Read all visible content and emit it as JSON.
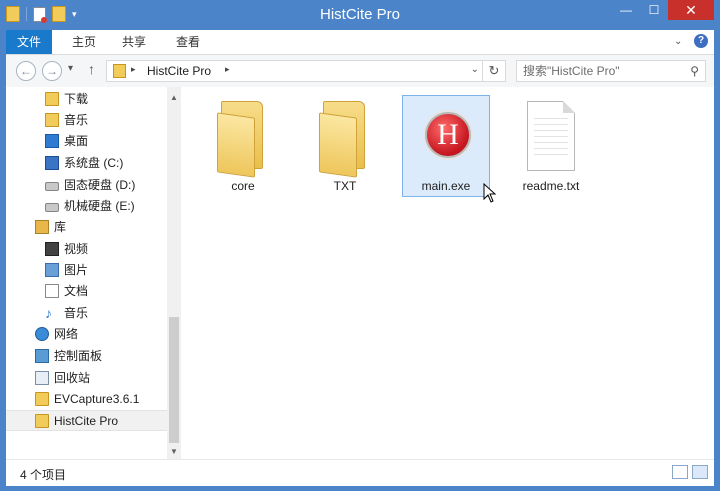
{
  "window": {
    "title": "HistCite Pro",
    "controls": {
      "minimize": "—",
      "maximize": "☐",
      "close": "✕"
    },
    "close_color": "#c7302b",
    "frame_color": "#4b84c9"
  },
  "quick_access": {
    "icons": [
      "folder-icon",
      "properties-icon",
      "new-folder-icon",
      "customize-arrow-icon"
    ]
  },
  "ribbon": {
    "tabs": [
      {
        "label": "文件"
      },
      {
        "label": "主页"
      },
      {
        "label": "共享"
      },
      {
        "label": "查看"
      }
    ],
    "help": "?"
  },
  "address": {
    "back": "←",
    "forward": "→",
    "up": "↑",
    "crumb": "HistCite Pro",
    "search_placeholder": "搜索\"HistCite Pro\""
  },
  "nav": {
    "items": [
      {
        "label": "下载",
        "icon": "downloads-folder-icon"
      },
      {
        "label": "音乐",
        "icon": "music-folder-icon"
      },
      {
        "label": "桌面",
        "icon": "desktop-icon"
      },
      {
        "label": "系统盘 (C:)",
        "icon": "system-drive-icon"
      },
      {
        "label": "固态硬盘 (D:)",
        "icon": "drive-icon"
      },
      {
        "label": "机械硬盘 (E:)",
        "icon": "drive-icon"
      },
      {
        "label": "库",
        "icon": "libraries-icon"
      },
      {
        "label": "视频",
        "icon": "videos-icon"
      },
      {
        "label": "图片",
        "icon": "pictures-icon"
      },
      {
        "label": "文档",
        "icon": "documents-icon"
      },
      {
        "label": "音乐",
        "icon": "music-note-icon"
      },
      {
        "label": "网络",
        "icon": "network-icon"
      },
      {
        "label": "控制面板",
        "icon": "control-panel-icon"
      },
      {
        "label": "回收站",
        "icon": "recycle-bin-icon"
      },
      {
        "label": "EVCapture3.6.1",
        "icon": "folder-icon"
      },
      {
        "label": "HistCite Pro",
        "icon": "folder-icon",
        "selected": true
      }
    ]
  },
  "files": [
    {
      "name": "core",
      "type": "folder"
    },
    {
      "name": "TXT",
      "type": "folder"
    },
    {
      "name": "main.exe",
      "type": "exe",
      "selected": true,
      "icon_letter": "H"
    },
    {
      "name": "readme.txt",
      "type": "txt"
    }
  ],
  "status": {
    "count": "4 个项目"
  }
}
